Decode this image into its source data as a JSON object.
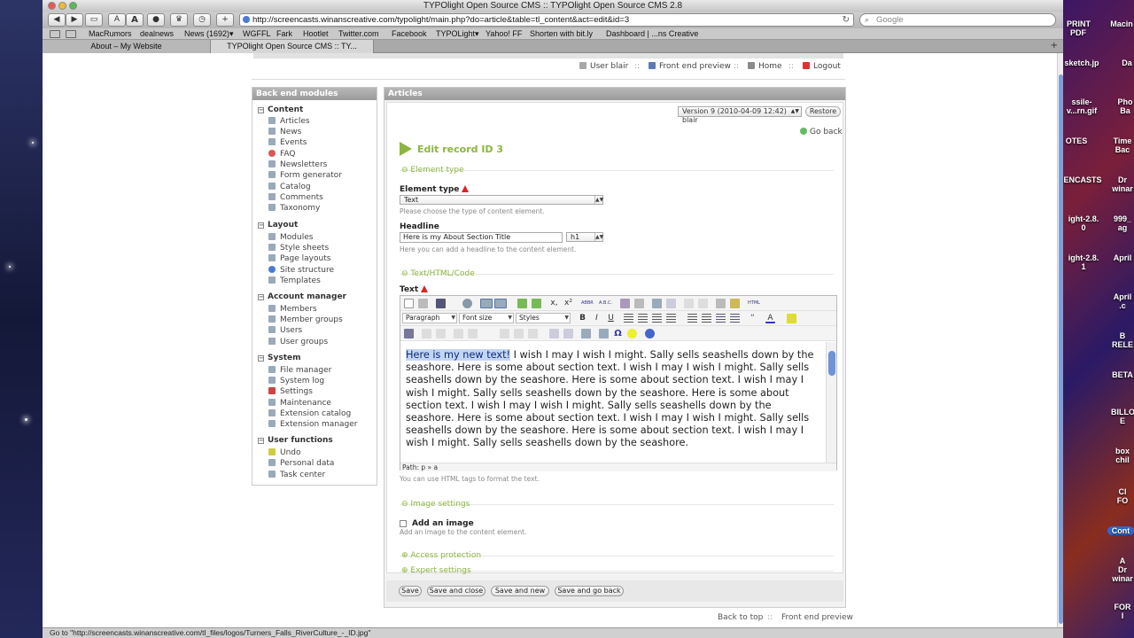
{
  "window": {
    "title": "TYPOlight Open Source CMS :: TYPOlight Open Source CMS 2.8"
  },
  "toolbar": {
    "url": "http://screencasts.winanscreative.com/typolight/main.php?do=article&table=tl_content&act=edit&id=3",
    "search_placeholder": "Google",
    "btn_text_small": "A",
    "btn_text_large": "A",
    "btn_add": "+"
  },
  "bookmarks": [
    "MacRumors",
    "dealnews",
    "News (1692)▾",
    "WGFFL",
    "Fark",
    "Hootlet",
    "Twitter.com",
    "Facebook",
    "TYPOLight▾",
    "Yahoo! FF",
    "Shorten with bit.ly",
    "Dashboard | ...ns Creative"
  ],
  "tabs": [
    {
      "label": "About – My Website"
    },
    {
      "label": "TYPOlight Open Source CMS :: TY..."
    }
  ],
  "header": {
    "user": "User blair",
    "sep": "::",
    "front_end_preview": "Front end preview",
    "home": "Home",
    "logout": "Logout"
  },
  "sidebar": {
    "title": "Back end modules",
    "groups": [
      {
        "label": "Content",
        "items": [
          "Articles",
          "News",
          "Events",
          "FAQ",
          "Newsletters",
          "Form generator",
          "Catalog",
          "Comments",
          "Taxonomy"
        ]
      },
      {
        "label": "Layout",
        "items": [
          "Modules",
          "Style sheets",
          "Page layouts",
          "Site structure",
          "Templates"
        ]
      },
      {
        "label": "Account manager",
        "items": [
          "Members",
          "Member groups",
          "Users",
          "User groups"
        ]
      },
      {
        "label": "System",
        "items": [
          "File manager",
          "System log",
          "Settings",
          "Maintenance",
          "Extension catalog",
          "Extension manager"
        ]
      },
      {
        "label": "User functions",
        "items": [
          "Undo",
          "Personal data",
          "Task center"
        ]
      }
    ]
  },
  "main": {
    "title": "Articles",
    "version_select": "Version 9 (2010-04-09 12:42) blair",
    "restore": "Restore",
    "go_back": "Go back",
    "edit_title": "Edit record ID 3",
    "legend_element_type": "Element type",
    "element_type_label": "Element type",
    "element_type_value": "Text",
    "element_type_help": "Please choose the type of content element.",
    "headline_label": "Headline",
    "headline_value": "Here is my About Section Title",
    "headline_level": "h1",
    "headline_help": "Here you can add a headline to the content element.",
    "legend_text": "Text/HTML/Code",
    "text_label": "Text",
    "editor": {
      "format_select": "Paragraph",
      "fontsize_select": "Font size",
      "styles_select": "Styles",
      "bold": "B",
      "italic": "I",
      "underline": "U",
      "highlighted": "Here is my new text!",
      "body": " I wish I may I wish I might. Sally sells seashells down by the seashore. Here is some about section text. I wish I may I wish I might. Sally sells seashells down by the seashore. Here is some about section text. I wish I may I wish I might. Sally sells seashells down by the seashore. Here is some about section text. I wish I may I wish I might. Sally sells seashells down by the seashore. Here is some about section text. I wish I may I wish I might. Sally sells seashells down by the seashore. Here is some about section text. I wish I may I wish I might. Sally sells seashells down by the seashore.",
      "path": "Path: p » a"
    },
    "text_help": "You can use HTML tags to format the text.",
    "legend_image": "Image settings",
    "add_image_label": "Add an image",
    "add_image_help": "Add an image to the content element.",
    "legend_access": "Access protection",
    "legend_expert": "Expert settings",
    "buttons": {
      "save": "Save",
      "save_close": "Save and close",
      "save_new": "Save and new",
      "save_back": "Save and go back"
    }
  },
  "footer": {
    "back_to_top": "Back to top",
    "sep": "::",
    "front_end_preview": "Front end preview"
  },
  "statusbar": "Go to \"http://screencasts.winanscreative.com/tl_files/logos/Turners_Falls_RiverCulture_-_ID.jpg\"",
  "desktop_icons": [
    "PRINT",
    "PDF",
    "Macin",
    "sketch.jp",
    "Da",
    "ssile-",
    "v...rn.gif",
    "Pho",
    "Ba",
    "OTES",
    "Time",
    "Bac",
    "ENCASTS",
    "Dr",
    "winar",
    "ight-2.8.",
    "999_",
    "0",
    "ag",
    "ight-2.8.",
    "April",
    "1",
    "April",
    ".c",
    "B",
    "RELE",
    "BETA",
    "BILLO",
    "E",
    "box",
    "chil",
    "Cl",
    "FO",
    "Cont",
    "A",
    "Dr",
    "winar",
    "FOR",
    "I"
  ]
}
